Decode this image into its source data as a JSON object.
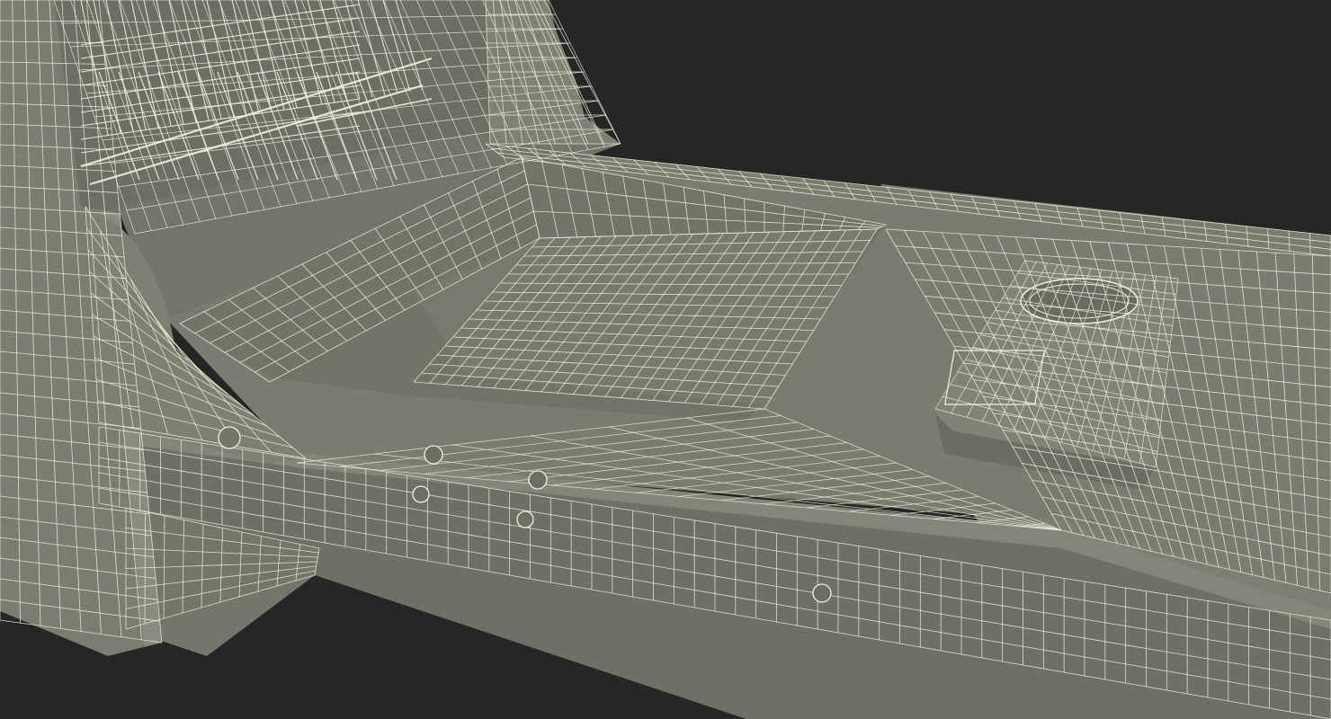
{
  "scene": {
    "subject": "dishwasher-wireframe-render",
    "colors": {
      "background": "#262626",
      "surface": "#7b7c70",
      "surface_light": "#8a8b7e",
      "surface_dark": "#66675c",
      "wire": "#f2f1dc"
    }
  }
}
